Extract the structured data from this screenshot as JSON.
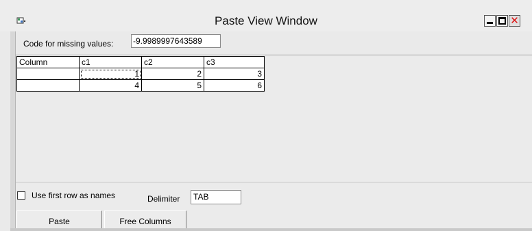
{
  "window": {
    "title": "Paste View Window"
  },
  "titlebar_buttons": {
    "minimize_icon": "minimize-icon",
    "maximize_icon": "maximize-icon",
    "close_icon": "close-icon",
    "close_glyph": "✕"
  },
  "missing": {
    "label": "Code for missing values:",
    "value": "-9.9989997643589"
  },
  "grid": {
    "headers": [
      "Column",
      "c1",
      "c2",
      "c3"
    ],
    "rows": [
      [
        "",
        "1",
        "2",
        "3"
      ],
      [
        "",
        "4",
        "5",
        "6"
      ]
    ]
  },
  "options": {
    "use_first_row_label": "Use first row as names",
    "use_first_row_checked": false,
    "delimiter_label": "Delimiter",
    "delimiter_value": "TAB"
  },
  "buttons": {
    "paste": "Paste",
    "free_columns": "Free Columns"
  },
  "colors": {
    "close_accent": "#dd1111",
    "window_bg": "#eaeaea"
  }
}
